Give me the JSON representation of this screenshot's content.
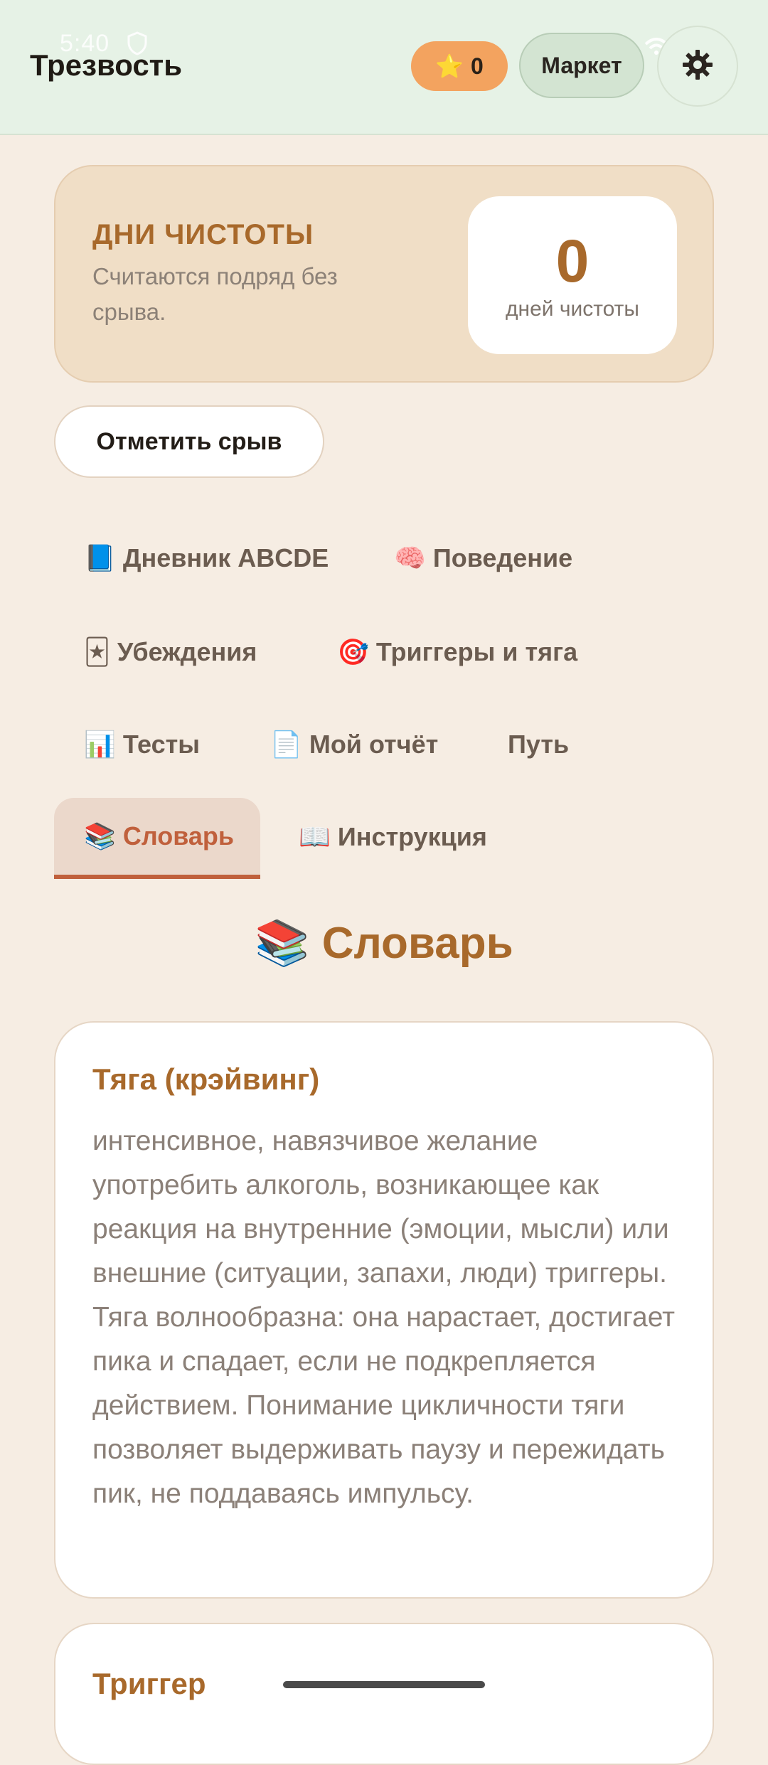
{
  "status_bar": {
    "time": "5:40"
  },
  "header": {
    "title": "Трезвость",
    "stars_icon": "⭐",
    "stars_count": "0",
    "market_label": "Маркет",
    "settings_icon": "gear-icon"
  },
  "streak": {
    "title": "ДНИ ЧИСТОТЫ",
    "subtitle": "Считаются подряд без срыва.",
    "value": "0",
    "unit": "дней чистоты"
  },
  "relapse_button": "Отметить срыв",
  "tabs": [
    {
      "icon": "📘",
      "label": "Дневник ABCDE",
      "active": false
    },
    {
      "icon": "🧠",
      "label": "Поведение",
      "active": false
    },
    {
      "icon": "🃏",
      "label": "Убеждения",
      "active": false
    },
    {
      "icon": "🎯",
      "label": "Триггеры и тяга",
      "active": false
    },
    {
      "icon": "📊",
      "label": "Тесты",
      "active": false
    },
    {
      "icon": "📄",
      "label": "Мой отчёт",
      "active": false
    },
    {
      "icon": "",
      "label": "Путь",
      "active": false
    },
    {
      "icon": "📚",
      "label": "Словарь",
      "active": true
    },
    {
      "icon": "📖",
      "label": "Инструкция",
      "active": false
    }
  ],
  "section": {
    "icon": "📚",
    "title": "Словарь"
  },
  "glossary": [
    {
      "term": "Тяга (крэйвинг)",
      "definition": "интенсивное, навязчивое желание употребить алкоголь, возникающее как реакция на внутренние (эмоции, мысли) или внешние (ситуации, запахи, люди) триггеры. Тяга волнообразна: она нарастает, достигает пика и спадает, если не подкрепляется действием. Понимание цикличности тяги позволяет выдерживать паузу и пережидать пик, не поддаваясь импульсу."
    },
    {
      "term": "Триггер",
      "definition": ""
    }
  ],
  "colors": {
    "accent": "#a8692b",
    "active_tab": "#c0603c",
    "header_bg": "#e6f2e6",
    "page_bg": "#f6ede3",
    "stars_pill": "#f3a35f"
  }
}
